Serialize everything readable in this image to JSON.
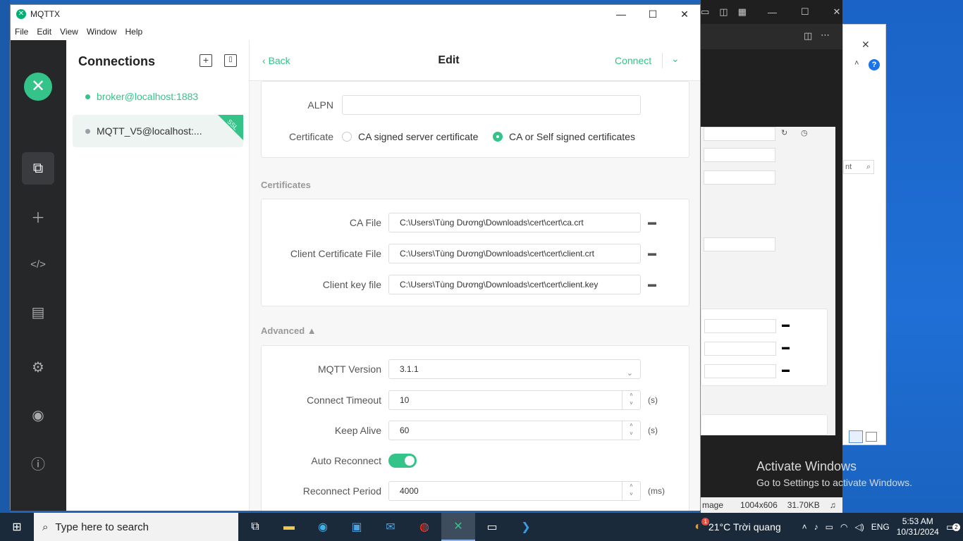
{
  "window": {
    "title": "MQTTX",
    "minimize": "—",
    "maximize": "☐",
    "close": "✕"
  },
  "menu": [
    "File",
    "Edit",
    "View",
    "Window",
    "Help"
  ],
  "connections": {
    "header": "Connections",
    "items": [
      {
        "name": "broker@localhost:1883",
        "status_color": "#34c388"
      },
      {
        "name": "MQTT_V5@localhost:...",
        "status_color": "#9aa0a6",
        "tag": "SSL"
      }
    ]
  },
  "edit": {
    "back_label": "Back",
    "title": "Edit",
    "connect_label": "Connect",
    "alpn_label": "ALPN",
    "alpn_value": "",
    "certificate_label": "Certificate",
    "cert_options": [
      {
        "label": "CA signed server certificate",
        "selected": false
      },
      {
        "label": "CA or Self signed certificates",
        "selected": true
      }
    ],
    "certificates_section": "Certificates",
    "ca_file_label": "CA File",
    "ca_file_value": "C:\\Users\\Tùng Dương\\Downloads\\cert\\cert\\ca.crt",
    "client_cert_label": "Client Certificate File",
    "client_cert_value": "C:\\Users\\Tùng Dương\\Downloads\\cert\\cert\\client.crt",
    "client_key_label": "Client key file",
    "client_key_value": "C:\\Users\\Tùng Dương\\Downloads\\cert\\cert\\client.key",
    "advanced_section": "Advanced",
    "mqtt_version_label": "MQTT Version",
    "mqtt_version_value": "3.1.1",
    "connect_timeout_label": "Connect Timeout",
    "connect_timeout_value": "10",
    "connect_timeout_unit": "(s)",
    "keep_alive_label": "Keep Alive",
    "keep_alive_value": "60",
    "keep_alive_unit": "(s)",
    "auto_reconnect_label": "Auto Reconnect",
    "auto_reconnect_on": true,
    "reconnect_period_label": "Reconnect Period",
    "reconnect_period_value": "4000",
    "reconnect_period_unit": "(ms)"
  },
  "background": {
    "status_text": "mage",
    "dimensions": "1004x606",
    "filesize": "31.70KB",
    "search_hint": "nt",
    "activate_title": "Activate Windows",
    "activate_sub": "Go to Settings to activate Windows."
  },
  "taskbar": {
    "search_placeholder": "Type here to search",
    "weather": "21°C  Trời quang",
    "weather_badge": "1",
    "language": "ENG",
    "time": "5:53 AM",
    "date": "10/31/2024",
    "notifications": "2"
  },
  "colors": {
    "accent": "#34c388",
    "rail": "#262729",
    "taskbar": "#1b2a3a"
  }
}
